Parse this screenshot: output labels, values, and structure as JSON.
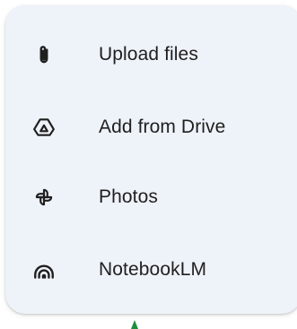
{
  "menu": {
    "items": [
      {
        "label": "Upload files",
        "icon": "paperclip-icon"
      },
      {
        "label": "Add from Drive",
        "icon": "drive-icon"
      },
      {
        "label": "Photos",
        "icon": "photos-pinwheel-icon"
      },
      {
        "label": "NotebookLM",
        "icon": "notebooklm-icon"
      }
    ]
  },
  "colors": {
    "menu_background": "#eef2f9",
    "text": "#1f1f1f",
    "cursor_indicator": "#1e8e3e"
  }
}
